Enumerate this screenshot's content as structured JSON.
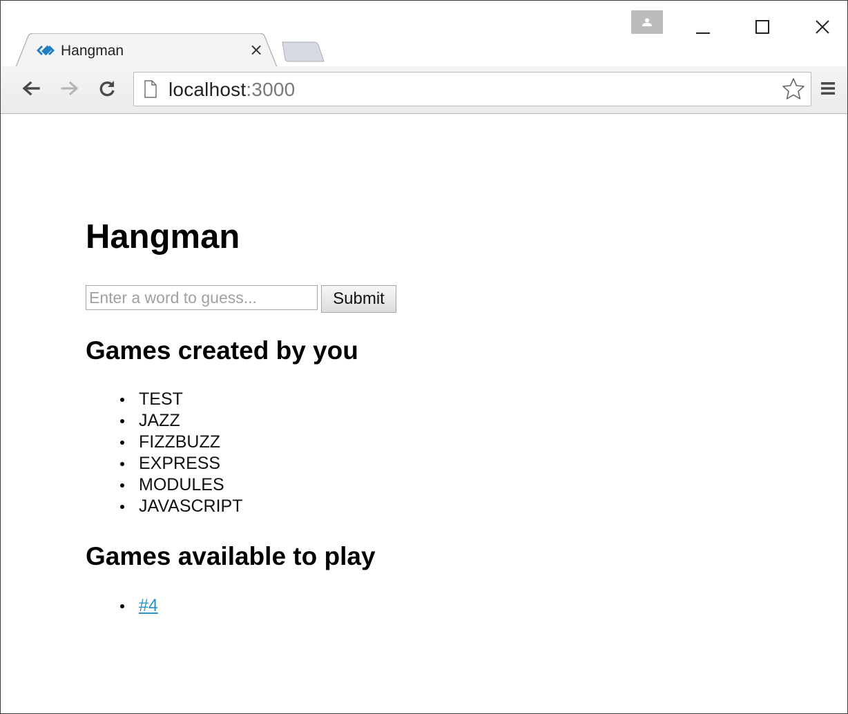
{
  "browser": {
    "tab": {
      "title": "Hangman",
      "close_glyph": "×",
      "favicon": "hangman-favicon"
    },
    "address_bar": {
      "host": "localhost",
      "port": ":3000"
    },
    "icons": {
      "back": "back-arrow-icon",
      "forward": "forward-arrow-icon",
      "reload": "reload-icon",
      "page": "page-icon",
      "bookmark": "star-icon",
      "menu": "hamburger-menu-icon",
      "profile": "profile-icon",
      "minimize": "minimize-icon",
      "maximize": "maximize-icon",
      "close": "close-icon"
    }
  },
  "page": {
    "title": "Hangman",
    "form": {
      "input_value": "",
      "input_placeholder": "Enter a word to guess...",
      "submit_label": "Submit"
    },
    "created_section": {
      "heading": "Games created by you",
      "items": [
        "TEST",
        "JAZZ",
        "FIZZBUZZ",
        "EXPRESS",
        "MODULES",
        "JAVASCRIPT"
      ]
    },
    "available_section": {
      "heading": "Games available to play",
      "items": [
        "#4"
      ]
    },
    "colors": {
      "link": "#2a93c9",
      "favicon": "#1f7fc1"
    }
  }
}
